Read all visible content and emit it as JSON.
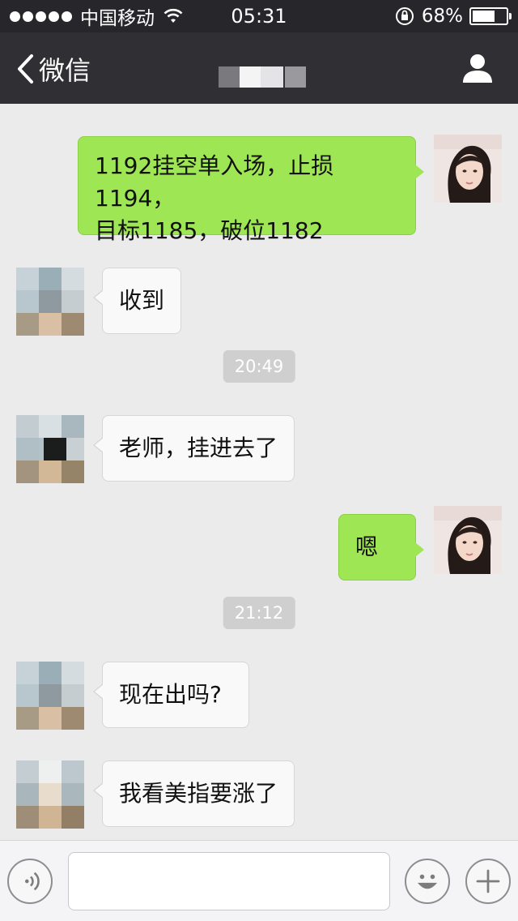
{
  "status_bar": {
    "carrier": "中国移动",
    "time": "05:31",
    "battery": "68%",
    "battery_level": 0.68
  },
  "nav": {
    "back_label": "微信",
    "title_obscured": true
  },
  "messages": [
    {
      "from": "me",
      "text": "1192挂空单入场，止损1194，\n目标1185，破位1182"
    },
    {
      "from": "other",
      "text": "收到"
    },
    {
      "type": "timestamp",
      "text": "20:49"
    },
    {
      "from": "other",
      "text": "老师，挂进去了"
    },
    {
      "from": "me",
      "text": "嗯"
    },
    {
      "type": "timestamp",
      "text": "21:12"
    },
    {
      "from": "other",
      "text": "现在出吗?"
    },
    {
      "from": "other",
      "text": "我看美指要涨了"
    }
  ],
  "input": {
    "placeholder": "",
    "value": ""
  },
  "icons": {
    "voice": "voice-icon",
    "emoji": "emoji-icon",
    "more": "plus-icon",
    "profile": "profile-icon",
    "back": "chevron-left-icon"
  },
  "colors": {
    "my_bubble": "#9ee654",
    "other_bubble": "#f9f9f9",
    "nav_bg": "#303034",
    "chat_bg": "#ebebeb"
  }
}
